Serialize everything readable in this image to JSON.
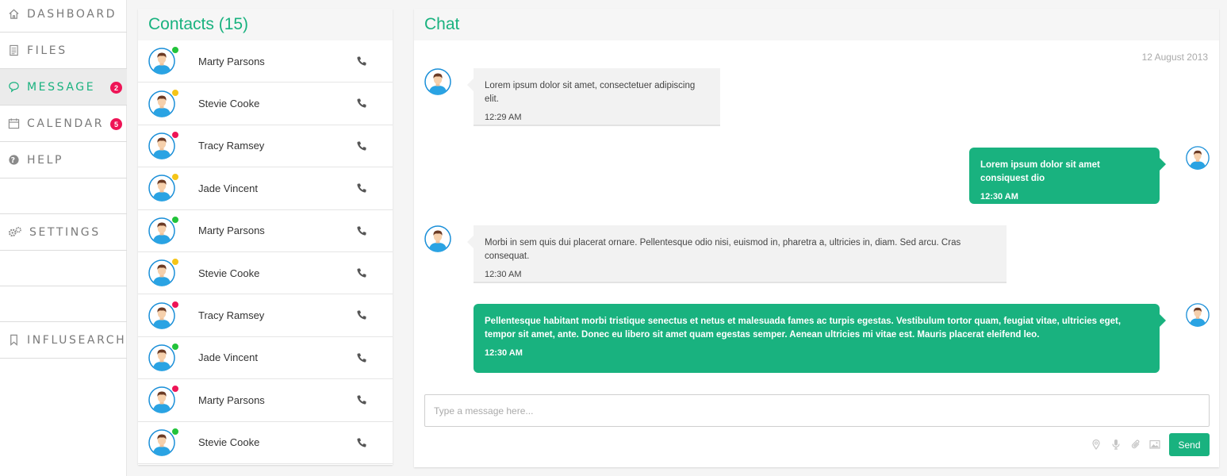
{
  "sidebar": {
    "items": [
      {
        "label": "DASHBOARD",
        "icon": "home-icon"
      },
      {
        "label": "FILES",
        "icon": "file-icon"
      },
      {
        "label": "MESSAGE",
        "icon": "chat-icon",
        "badge": "2",
        "active": true
      },
      {
        "label": "CALENDAR",
        "icon": "calendar-icon",
        "badge": "5"
      },
      {
        "label": "HELP",
        "icon": "help-icon"
      },
      {
        "label": "SETTINGS",
        "icon": "gears-icon"
      },
      {
        "label": "INFLUSEARCH",
        "icon": "bookmark-icon"
      }
    ]
  },
  "contacts": {
    "title": "Contacts (15)",
    "list": [
      {
        "name": "Marty Parsons",
        "status": "online"
      },
      {
        "name": "Stevie Cooke",
        "status": "away"
      },
      {
        "name": "Tracy Ramsey",
        "status": "busy"
      },
      {
        "name": "Jade Vincent",
        "status": "away"
      },
      {
        "name": "Marty Parsons",
        "status": "online"
      },
      {
        "name": "Stevie Cooke",
        "status": "away"
      },
      {
        "name": "Tracy Ramsey",
        "status": "busy"
      },
      {
        "name": "Jade Vincent",
        "status": "online"
      },
      {
        "name": "Marty Parsons",
        "status": "busy"
      },
      {
        "name": "Stevie Cooke",
        "status": "online"
      }
    ]
  },
  "status_colors": {
    "online": "#22c33a",
    "away": "#f5c518",
    "busy": "#ee1456"
  },
  "colors": {
    "accent": "#19b27f",
    "badge": "#ee1456"
  },
  "chat": {
    "title": "Chat",
    "date": "12 August 2013",
    "messages": [
      {
        "direction": "in",
        "text": "Lorem ipsum dolor sit amet, consectetuer adipiscing elit.",
        "time": "12:29 AM"
      },
      {
        "direction": "out",
        "text": "Lorem ipsum dolor sit amet consiquest dio",
        "time": "12:30 AM"
      },
      {
        "direction": "in",
        "text": "Morbi in sem quis dui placerat ornare. Pellentesque odio nisi, euismod in, pharetra a, ultricies in, diam. Sed arcu. Cras consequat.",
        "time": "12:30 AM"
      },
      {
        "direction": "out",
        "text": "Pellentesque habitant morbi tristique senectus et netus et malesuada fames ac turpis egestas. Vestibulum tortor quam, feugiat vitae, ultricies eget, tempor sit amet, ante. Donec eu libero sit amet quam egestas semper. Aenean ultricies mi vitae est. Mauris placerat eleifend leo.",
        "time": "12:30 AM"
      }
    ],
    "input": {
      "placeholder": "Type a message here...",
      "value": ""
    },
    "tools": [
      "location-icon",
      "microphone-icon",
      "paperclip-icon",
      "image-icon"
    ],
    "send_label": "Send"
  }
}
